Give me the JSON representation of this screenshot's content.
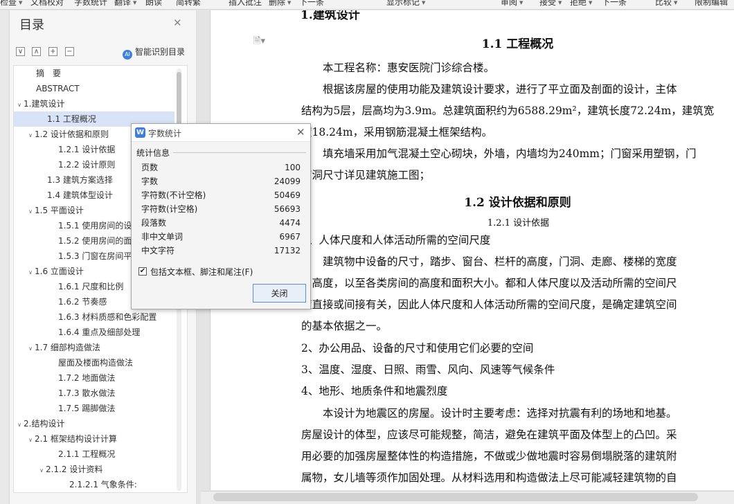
{
  "toolbar": {
    "items": [
      {
        "label": "检查",
        "has_dropdown": true
      },
      {
        "label": "文档校对",
        "has_dropdown": false
      },
      {
        "label": "字数统计",
        "has_dropdown": false
      },
      {
        "label": "翻译",
        "has_dropdown": true
      },
      {
        "label": "朗读",
        "has_dropdown": false
      },
      {
        "label": "简转繁",
        "has_dropdown": false
      },
      {
        "label": "插入批注",
        "has_dropdown": false
      },
      {
        "label": "删除",
        "has_dropdown": true
      },
      {
        "label": "下一条",
        "has_dropdown": false
      },
      {
        "label": "显示标记",
        "has_dropdown": true
      },
      {
        "label": "审阅",
        "has_dropdown": true
      },
      {
        "label": "接受",
        "has_dropdown": true
      },
      {
        "label": "拒绝",
        "has_dropdown": true
      },
      {
        "label": "下一条",
        "has_dropdown": false
      },
      {
        "label": "比较",
        "has_dropdown": true
      },
      {
        "label": "限制编辑",
        "has_dropdown": false
      }
    ]
  },
  "toc": {
    "title": "目录",
    "smart_label": "智能识别目录",
    "items": [
      {
        "label": "摘　要",
        "level": 1,
        "arrow": "",
        "selected": false
      },
      {
        "label": "ABSTRACT",
        "level": 1,
        "arrow": "",
        "selected": false
      },
      {
        "label": "1.建筑设计",
        "level": 1,
        "arrow": "∨",
        "selected": false
      },
      {
        "label": "1.1 工程概况",
        "level": 2,
        "arrow": "",
        "selected": true
      },
      {
        "label": "1.2 设计依据和原则",
        "level": 2,
        "arrow": "∨",
        "selected": false
      },
      {
        "label": "1.2.1  设计依据",
        "level": 3,
        "arrow": "",
        "selected": false
      },
      {
        "label": "1.2.2  设计原则",
        "level": 3,
        "arrow": "",
        "selected": false
      },
      {
        "label": "1.3  建筑方案选择",
        "level": 2,
        "arrow": "",
        "selected": false
      },
      {
        "label": "1.4  建筑体型设计",
        "level": 2,
        "arrow": "",
        "selected": false
      },
      {
        "label": "1.5  平面设计",
        "level": 2,
        "arrow": "∨",
        "selected": false
      },
      {
        "label": "1.5.1 使用房间的设计",
        "level": 3,
        "arrow": "",
        "selected": false
      },
      {
        "label": "1.5.2  使用房间的面积",
        "level": 3,
        "arrow": "",
        "selected": false
      },
      {
        "label": "1.5.3  门窗在房间平面",
        "level": 3,
        "arrow": "",
        "selected": false
      },
      {
        "label": "1.6  立面设计",
        "level": 2,
        "arrow": "∨",
        "selected": false
      },
      {
        "label": "1.6.1  尺度和比例",
        "level": 3,
        "arrow": "",
        "selected": false
      },
      {
        "label": "1.6.2  节奏感",
        "level": 3,
        "arrow": "",
        "selected": false
      },
      {
        "label": "1.6.3  材料质感和色彩配置",
        "level": 3,
        "arrow": "",
        "selected": false
      },
      {
        "label": "1.6.4  重点及细部处理",
        "level": 3,
        "arrow": "",
        "selected": false
      },
      {
        "label": "1.7  细部构造做法",
        "level": 2,
        "arrow": "∨",
        "selected": false
      },
      {
        "label": "屋面及楼面构造做法",
        "level": 3,
        "arrow": "",
        "selected": false
      },
      {
        "label": "1.7.2  地面做法",
        "level": 3,
        "arrow": "",
        "selected": false
      },
      {
        "label": "1.7.3    散水做法",
        "level": 3,
        "arrow": "",
        "selected": false
      },
      {
        "label": "1.7.5  踢脚做法",
        "level": 3,
        "arrow": "",
        "selected": false
      },
      {
        "label": "2.结构设计",
        "level": 1,
        "arrow": "∨",
        "selected": false
      },
      {
        "label": "2.1 框架结构设计计算",
        "level": 2,
        "arrow": "∨",
        "selected": false
      },
      {
        "label": "2.1.1  工程概况",
        "level": 3,
        "arrow": "",
        "selected": false
      },
      {
        "label": "2.1.2  设计资料",
        "level": 3,
        "arrow": "∨",
        "selected": false
      },
      {
        "label": "2.1.2.1 气象条件:",
        "level": 4,
        "arrow": "",
        "selected": false
      }
    ]
  },
  "document": {
    "top_fragment": "1.建筑设计",
    "lines": [
      {
        "kind": "heading",
        "text": "1.1 工程概况"
      },
      {
        "kind": "para",
        "text": "本工程名称：惠安医院门诊综合楼。"
      },
      {
        "kind": "para",
        "text": "根据该房屋的使用功能及建筑设计要求，进行了平立面及剖面的设计，主体"
      },
      {
        "kind": "para",
        "text": "结构为5层，层高均为3.9m。总建筑面积约为6588.29m²，建筑长度72.24m，建筑宽"
      },
      {
        "kind": "para",
        "text": "度18.24m，采用钢筋混凝土框架结构。"
      },
      {
        "kind": "para",
        "text": "填充墙采用加气混凝土空心砌块，外墙，内墙均为240mm；门窗采用塑钢，门"
      },
      {
        "kind": "para",
        "text": "窗洞尺寸详见建筑施工图；"
      },
      {
        "kind": "heading",
        "text": "1.2 设计依据和原则"
      },
      {
        "kind": "sub",
        "text": "1.2.1  设计依据"
      },
      {
        "kind": "para",
        "text": "1、人体尺度和人体活动所需的空间尺度"
      },
      {
        "kind": "para",
        "text": "建筑物中设备的尺寸，踏步、窗台、栏杆的高度，门洞、走廊、楼梯的宽度"
      },
      {
        "kind": "para",
        "text": "和高度，以至各类房间的高度和面积大小。都和人体尺度以及活动所需的空间尺"
      },
      {
        "kind": "para",
        "text": "度直接或间接有关，因此人体尺度和人体活动所需的空间尺度，是确定建筑空间"
      },
      {
        "kind": "para",
        "text": "的基本依据之一。"
      },
      {
        "kind": "para",
        "text": "2、办公用品、设备的尺寸和使用它们必要的空间"
      },
      {
        "kind": "para",
        "text": "3、温度、湿度、日照、雨雪、风向、风速等气候条件"
      },
      {
        "kind": "para",
        "text": "4、地形、地质条件和地震烈度"
      },
      {
        "kind": "para",
        "text": "本设计为地震区的房屋。设计时主要考虑：选择对抗震有利的场地和地基。"
      },
      {
        "kind": "para",
        "text": "房屋设计的体型，应该尽可能规整，简洁，避免在建筑平面及体型上的凸凹。采"
      },
      {
        "kind": "para",
        "text": "用必要的加强房屋整体性的构造措施，不做或少做地震时容易倒塌脱落的建筑附"
      },
      {
        "kind": "para",
        "text": "属物，女儿墙等须作加固处理。从材料选用和构造做法上尽可能减轻建筑物的自"
      }
    ]
  },
  "word_count_dialog": {
    "title": "字数统计",
    "section_label": "统计信息",
    "stats": [
      {
        "label": "页数",
        "value": "100"
      },
      {
        "label": "字数",
        "value": "24099"
      },
      {
        "label": "字符数(不计空格)",
        "value": "50469"
      },
      {
        "label": "字符数(计空格)",
        "value": "56693"
      },
      {
        "label": "段落数",
        "value": "4474"
      },
      {
        "label": "非中文单词",
        "value": "6967"
      },
      {
        "label": "中文字符",
        "value": "17132"
      }
    ],
    "checkbox_label": "包括文本框、脚注和尾注(F)",
    "checkbox_checked": true,
    "close_button": "关闭"
  },
  "colors": {
    "accent": "#3d7ede",
    "selection": "#d9e3f7",
    "page": "#ffffff"
  }
}
